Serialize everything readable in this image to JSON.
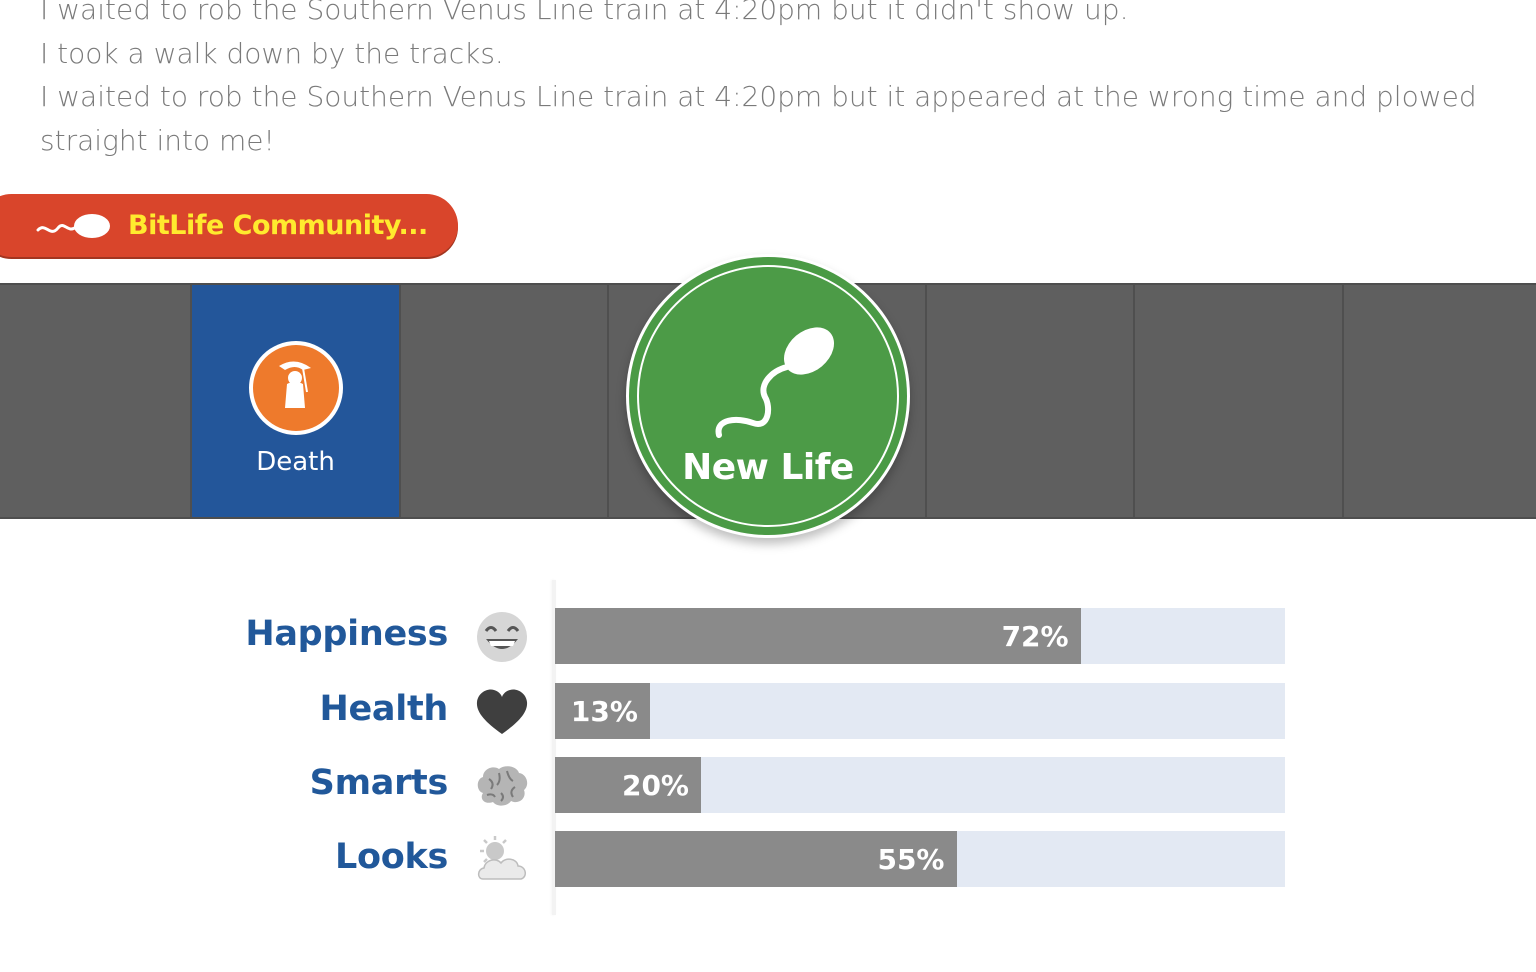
{
  "log": {
    "lines": [
      "I waited to rob the Southern Venus Line train at 4:20pm but it didn't show up.",
      "I took a walk down by the tracks.",
      "I waited to rob the Southern Venus Line train at 4:20pm but it appeared at the wrong time and plowed straight into me!"
    ]
  },
  "community_button": {
    "label": "BitLife Community...",
    "icon": "sperm-icon",
    "color": "#d9452b",
    "text_color": "#ffea2e"
  },
  "action_bar": {
    "death": {
      "label": "Death",
      "icon": "grim-reaper-icon",
      "color": "#23569a"
    },
    "new_life": {
      "label": "New Life",
      "icon": "sperm-icon",
      "color": "#4a9a45"
    }
  },
  "stats": [
    {
      "name": "Happiness",
      "icon": "grinning-face-icon",
      "percent": 72,
      "label": "72%"
    },
    {
      "name": "Health",
      "icon": "heart-icon",
      "percent": 13,
      "label": "13%"
    },
    {
      "name": "Smarts",
      "icon": "brain-icon",
      "percent": 20,
      "label": "20%"
    },
    {
      "name": "Looks",
      "icon": "sun-behind-cloud-icon",
      "percent": 55,
      "label": "55%"
    }
  ]
}
